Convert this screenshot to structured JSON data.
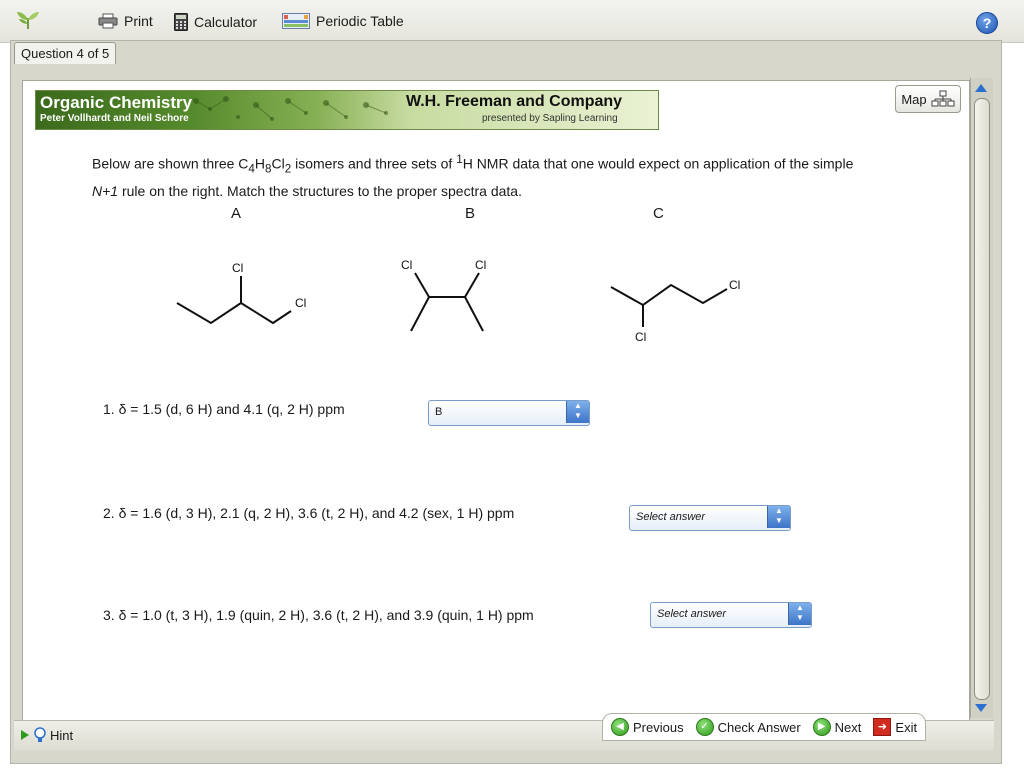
{
  "toolbar": {
    "print_label": "Print",
    "calculator_label": "Calculator",
    "periodic_table_label": "Periodic Table",
    "help_label": "?"
  },
  "question_tab": "Question 4 of 5",
  "banner": {
    "title": "Organic Chemistry",
    "subtitle": "Peter Vollhardt and Neil Schore",
    "publisher": "W.H. Freeman and Company",
    "publisher_sub": "presented by Sapling Learning"
  },
  "map_label": "Map",
  "intro": {
    "part1": "Below are shown three C",
    "sub1": "4",
    "part2": "H",
    "sub2": "8",
    "part3": "Cl",
    "sub3": "2",
    "part4": " isomers and three sets of ",
    "sup1": "1",
    "part5": "H NMR data that one would expect on application of the simple ",
    "rule": "N+1",
    "part6": " rule on the right. Match the structures to the proper spectra data."
  },
  "structures": {
    "labels": [
      "A",
      "B",
      "C"
    ],
    "atom_label": "Cl"
  },
  "questions": [
    {
      "number": "1.",
      "text": "δ = 1.5 (d, 6 H) and 4.1 (q, 2 H) ppm",
      "selected": "B"
    },
    {
      "number": "2.",
      "text": "δ = 1.6 (d, 3 H), 2.1 (q, 2 H), 3.6 (t, 2 H), and 4.2 (sex, 1 H) ppm",
      "selected": "Select answer"
    },
    {
      "number": "3.",
      "text": "δ = 1.0 (t, 3 H), 1.9 (quin, 2 H), 3.6 (t, 2 H), and 3.9 (quin, 1 H) ppm",
      "selected": "Select answer"
    }
  ],
  "bottom": {
    "hint_label": "Hint",
    "previous_label": "Previous",
    "check_label": "Check Answer",
    "next_label": "Next",
    "exit_label": "Exit"
  },
  "colors": {
    "banner_green": "#3b6a1c",
    "select_border": "#7a9cc8",
    "nav_green": "#2f9a1c",
    "exit_red": "#d12a1e",
    "scroll_blue": "#2d6fd0"
  }
}
